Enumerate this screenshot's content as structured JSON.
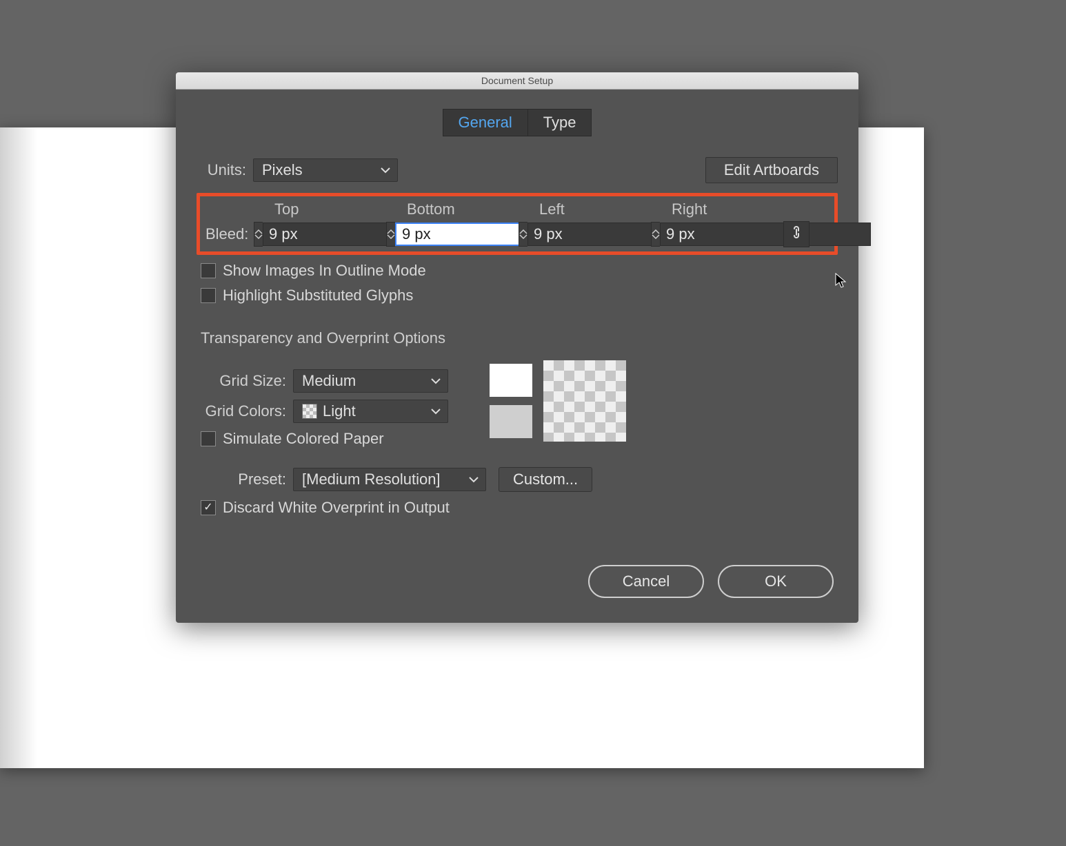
{
  "dialog": {
    "title": "Document Setup",
    "tabs": {
      "general": "General",
      "type": "Type"
    },
    "units": {
      "label": "Units:",
      "value": "Pixels"
    },
    "editArtboards": "Edit Artboards",
    "bleed": {
      "label": "Bleed:",
      "headers": {
        "top": "Top",
        "bottom": "Bottom",
        "left": "Left",
        "right": "Right"
      },
      "values": {
        "top": "9 px",
        "bottom": "9 px",
        "left": "9 px",
        "right": "9 px"
      }
    },
    "checks": {
      "showOutline": "Show Images In Outline Mode",
      "highlightGlyphs": "Highlight Substituted Glyphs",
      "simulatePaper": "Simulate Colored Paper",
      "discardWhite": "Discard White Overprint in Output"
    },
    "section": "Transparency and Overprint Options",
    "gridSize": {
      "label": "Grid Size:",
      "value": "Medium"
    },
    "gridColors": {
      "label": "Grid Colors:",
      "value": "Light"
    },
    "preset": {
      "label": "Preset:",
      "value": "[Medium Resolution]",
      "customBtn": "Custom..."
    },
    "buttons": {
      "cancel": "Cancel",
      "ok": "OK"
    }
  }
}
